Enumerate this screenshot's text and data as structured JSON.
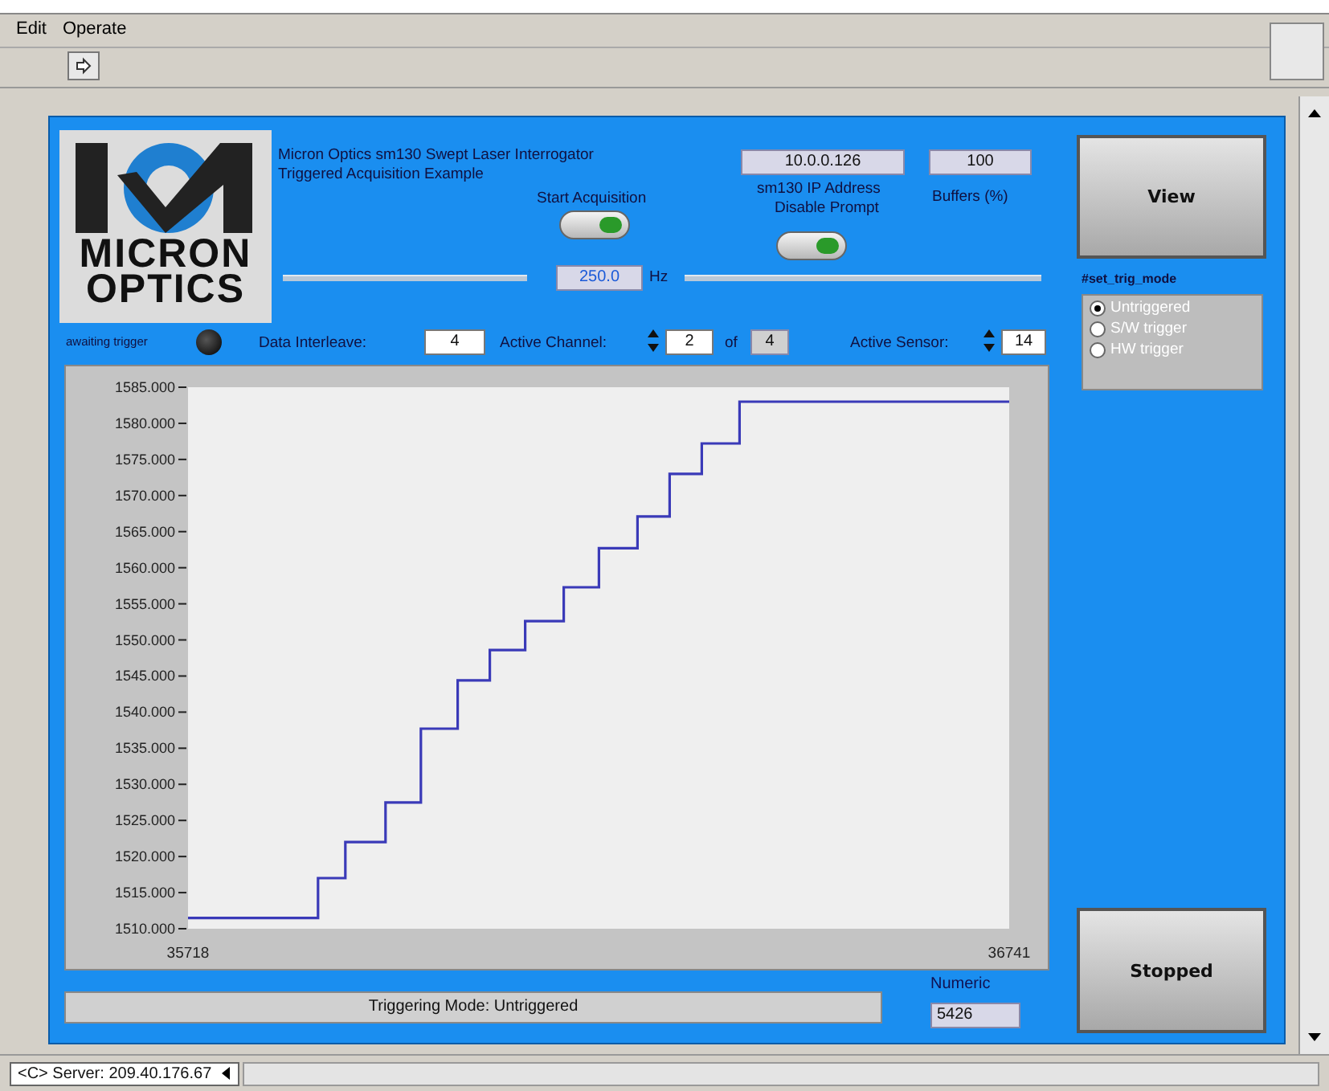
{
  "menu": [
    {
      "label": "Edit"
    },
    {
      "label": "Operate"
    }
  ],
  "panel": {
    "title_lines": [
      "Micron Optics sm130 Swept Laser Interrogator",
      "Triggered Acquisition Example"
    ],
    "logo": {
      "lines": [
        "MICRON",
        "OPTICS"
      ]
    },
    "start_acquisition": {
      "label": "Start Acquisition",
      "on": true
    },
    "rate": {
      "value": "250.0",
      "unit": "Hz"
    },
    "ip_address": {
      "value": "10.0.0.126",
      "label": "sm130 IP Address"
    },
    "disable_prompt": {
      "label": "Disable Prompt",
      "on": true
    },
    "buffers": {
      "value": "100",
      "label": "Buffers (%)"
    },
    "view_button": "View",
    "trig_mode": {
      "label": "#set_trig_mode",
      "options": [
        {
          "label": "Untriggered",
          "selected": true
        },
        {
          "label": "S/W trigger",
          "selected": false
        },
        {
          "label": "HW trigger",
          "selected": false
        }
      ]
    },
    "awaiting_trigger": {
      "label": "awaiting trigger",
      "on": false
    },
    "data_interleave": {
      "label": "Data Interleave:",
      "value": "4"
    },
    "active_channel": {
      "label": "Active Channel:",
      "value": "2",
      "of_label": "of",
      "total": "4"
    },
    "active_sensor": {
      "label": "Active Sensor:",
      "value": "14"
    },
    "chart_data": {
      "type": "line",
      "xlim": [
        35718,
        36741
      ],
      "ylim": [
        1510,
        1585
      ],
      "xticks": [
        35718,
        36741
      ],
      "yticks": [
        {
          "value": 1585,
          "label": "1585.000"
        },
        {
          "value": 1580,
          "label": "1580.000"
        },
        {
          "value": 1575,
          "label": "1575.000"
        },
        {
          "value": 1570,
          "label": "1570.000"
        },
        {
          "value": 1565,
          "label": "1565.000"
        },
        {
          "value": 1560,
          "label": "1560.000"
        },
        {
          "value": 1555,
          "label": "1555.000"
        },
        {
          "value": 1550,
          "label": "1550.000"
        },
        {
          "value": 1545,
          "label": "1545.000"
        },
        {
          "value": 1540,
          "label": "1540.000"
        },
        {
          "value": 1535,
          "label": "1535.000"
        },
        {
          "value": 1530,
          "label": "1530.000"
        },
        {
          "value": 1525,
          "label": "1525.000"
        },
        {
          "value": 1520,
          "label": "1520.000"
        },
        {
          "value": 1515,
          "label": "1515.000"
        },
        {
          "value": 1510,
          "label": "1510.000"
        }
      ],
      "x": [
        35718,
        35880,
        35880,
        35914,
        35914,
        35964,
        35964,
        36008,
        36008,
        36054,
        36054,
        36094,
        36094,
        36138,
        36138,
        36186,
        36186,
        36230,
        36230,
        36278,
        36278,
        36318,
        36318,
        36358,
        36358,
        36405,
        36405,
        36741
      ],
      "series": [
        {
          "color": "#3a3ab8",
          "values": [
            1511.5,
            1511.5,
            1517,
            1517,
            1522,
            1522,
            1527.5,
            1527.5,
            1537.7,
            1537.7,
            1544.4,
            1544.4,
            1548.6,
            1548.6,
            1552.6,
            1552.6,
            1557.3,
            1557.3,
            1562.7,
            1562.7,
            1567.1,
            1567.1,
            1573,
            1573,
            1577.2,
            1577.2,
            1583,
            1583
          ]
        }
      ]
    },
    "status_message": "Triggering Mode: Untriggered",
    "numeric": {
      "label": "Numeric",
      "value": "5426"
    },
    "stopped_button": "Stopped"
  },
  "status_bar": {
    "server": "<C> Server: 209.40.176.67"
  }
}
